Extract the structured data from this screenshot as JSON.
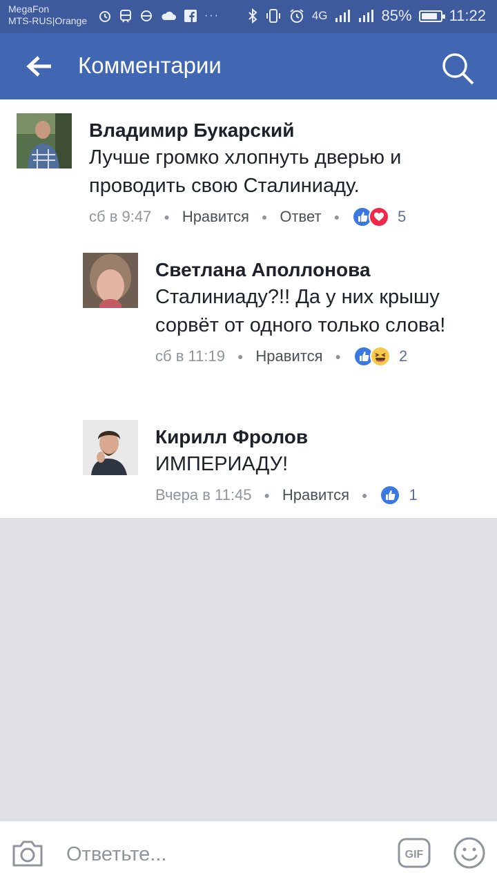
{
  "status_bar": {
    "carrier1": "MegaFon",
    "carrier2": "MTS-RUS|Orange",
    "network": "4G",
    "battery": "85%",
    "battery_level": 0.85,
    "time": "11:22",
    "more": "···"
  },
  "app_bar": {
    "title": "Комментарии",
    "back_icon": "arrow-left-icon",
    "search_icon": "search-icon"
  },
  "comments": [
    {
      "author": "Владимир Букарский",
      "text": "Лучше громко хлопнуть дверью и проводить свою Сталиниаду.",
      "time": "сб в 9:47",
      "like_label": "Нравится",
      "reply_label": "Ответ",
      "reactions": [
        "like",
        "love"
      ],
      "reaction_count": "5"
    },
    {
      "author": "Светлана Аполлонова",
      "text": "Сталиниаду?!! Да у них крышу сорвёт от одного только слова!",
      "time": "сб в 11:19",
      "like_label": "Нравится",
      "reactions": [
        "like",
        "haha"
      ],
      "reaction_count": "2"
    },
    {
      "author": "Кирилл Фролов",
      "text": "ИМПЕРИАДУ!",
      "time": "Вчера в 11:45",
      "like_label": "Нравится",
      "reactions": [
        "like"
      ],
      "reaction_count": "1"
    }
  ],
  "composer": {
    "placeholder": "Ответьте...",
    "gif_label": "GIF",
    "camera_icon": "camera-icon",
    "emoji_icon": "smiley-icon"
  },
  "colors": {
    "status_bar": "#3c5a9c",
    "app_bar": "#4267b2",
    "like": "#3b79e0",
    "love": "#f0284a",
    "haha": "#f7c84a",
    "background": "#dfe1e4"
  }
}
